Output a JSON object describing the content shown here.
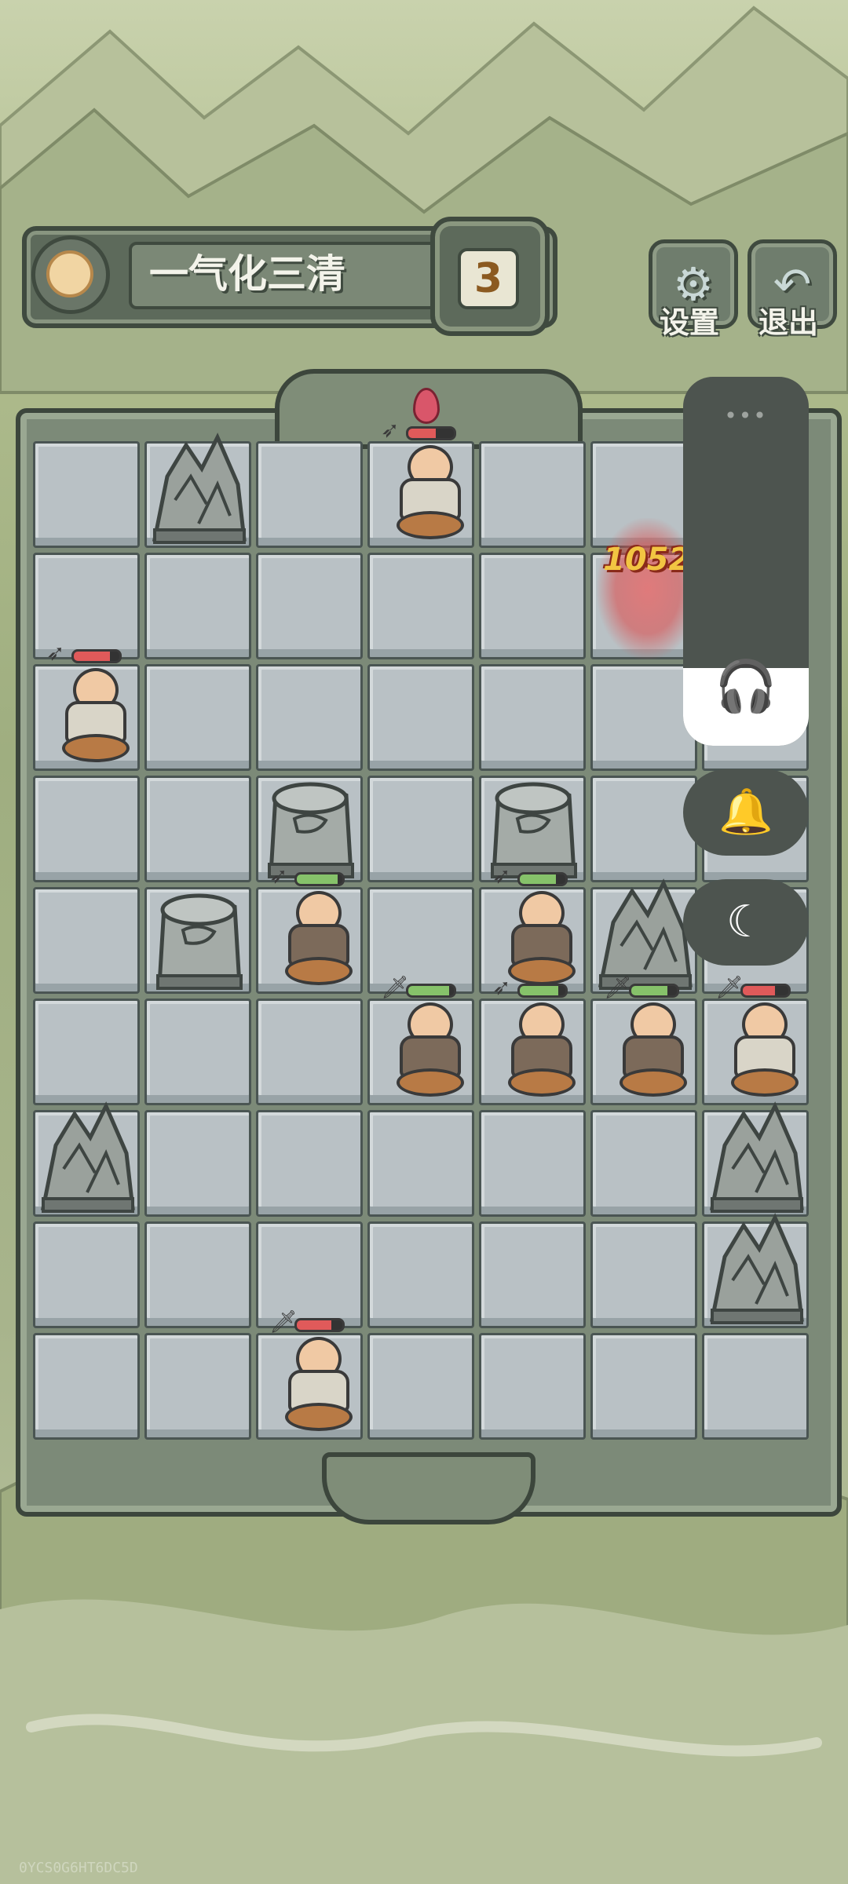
{
  "header": {
    "stage_title": "一气化三清",
    "level_number": "3",
    "settings_label": "设置",
    "exit_label": "退出",
    "settings_icon": "gear-icon",
    "exit_icon": "back-arrow-icon"
  },
  "board": {
    "columns": 7,
    "rows": 9,
    "rocks": [
      {
        "row": 0,
        "col": 1,
        "type": "mountain"
      },
      {
        "row": 3,
        "col": 2,
        "type": "stump"
      },
      {
        "row": 3,
        "col": 4,
        "type": "stump"
      },
      {
        "row": 4,
        "col": 1,
        "type": "stump"
      },
      {
        "row": 4,
        "col": 5,
        "type": "mountain"
      },
      {
        "row": 6,
        "col": 0,
        "type": "mountain"
      },
      {
        "row": 6,
        "col": 6,
        "type": "mountain"
      },
      {
        "row": 7,
        "col": 6,
        "type": "mountain"
      }
    ],
    "units": [
      {
        "row": 0,
        "col": 3,
        "team": "enemy",
        "hp": 0.6,
        "weapon": "bow"
      },
      {
        "row": 2,
        "col": 0,
        "team": "enemy",
        "hp": 0.8,
        "weapon": "bow"
      },
      {
        "row": 4,
        "col": 2,
        "team": "ally",
        "hp": 0.9,
        "weapon": "bow"
      },
      {
        "row": 4,
        "col": 4,
        "team": "ally",
        "hp": 0.8,
        "weapon": "bow"
      },
      {
        "row": 5,
        "col": 3,
        "team": "ally",
        "hp": 0.9,
        "weapon": "sword"
      },
      {
        "row": 5,
        "col": 4,
        "team": "ally",
        "hp": 0.85,
        "weapon": "bow"
      },
      {
        "row": 5,
        "col": 5,
        "team": "ally",
        "hp": 0.8,
        "weapon": "sword"
      },
      {
        "row": 5,
        "col": 6,
        "team": "enemy",
        "hp": 0.7,
        "weapon": "sword"
      },
      {
        "row": 8,
        "col": 2,
        "team": "enemy",
        "hp": 0.75,
        "weapon": "sword"
      }
    ],
    "damage_popup": "1052"
  },
  "colors": {
    "ally_hp": "#86c26a",
    "enemy_hp": "#e05a5a",
    "volume_accent": "#2f7cf6"
  },
  "overlay": {
    "volume_level": 0.21,
    "volume_icon": "headphones-icon",
    "ring_icon": "bell-icon",
    "dnd_icon": "moon-icon"
  },
  "watermark": "0YCS0G6HT6DC5D"
}
